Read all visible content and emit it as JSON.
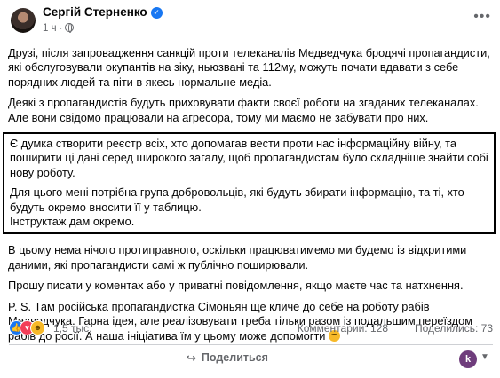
{
  "post": {
    "author": "Сергій Стерненко",
    "time": "1 ч",
    "paragraphs": [
      "Друзі, після запровадження санкцій проти телеканалів Медведчука бродячі пропагандисти, які обслуговували окупантів на зіку, ньюзвані та 112му, можуть почати вдавати з себе порядних людей та піти в якесь нормальне медіа.",
      "Деякі з пропагандистів будуть приховувати факти своєї роботи на згаданих телеканалах. Але вони свідомо працювали на агресора, тому ми маємо не забувати про них."
    ],
    "boxed_paragraphs": [
      "Є думка створити реєстр всіх, хто допомагав вести проти нас інформаційну війну, та поширити ці дані серед широкого загалу, щоб пропагандистам було складніше знайти собі нову роботу.",
      "Для цього мені потрібна група добровольців, які будуть збирати інформацію, та ті, хто будуть окремо вносити її у таблицю.\nІнструктаж дам окремо."
    ],
    "after_paragraphs": [
      "В цьому нема нічого протиправного, оскільки працюватимемо ми будемо із відкритими даними, які пропагандисти самі ж публічно поширювали.",
      "Прошу писати у коментах або у приватні повідомлення, якщо маєте час та натхнення."
    ],
    "ps": "P. S. Там російська пропагандистка Сімоньян ще кличе до себе на роботу рабів Медведчука. Гарна ідея, але реалізовувати треба тільки разом із подальшим переїздом рабів до росії. А наша ініціатива їм у цьому може допомогти",
    "ps_emoji": "grinning-emoji"
  },
  "stats": {
    "reaction_icons": [
      "like-icon",
      "love-icon",
      "haha-icon"
    ],
    "reactions_count": "1,5 тыс.",
    "comments": "Комментарии: 128",
    "shares": "Поделились: 73"
  },
  "actions": {
    "share_label": "Поделиться",
    "profile_initial": "k"
  },
  "colors": {
    "accent": "#1877f2",
    "secondary_text": "#65676b",
    "box_border": "#000000"
  }
}
